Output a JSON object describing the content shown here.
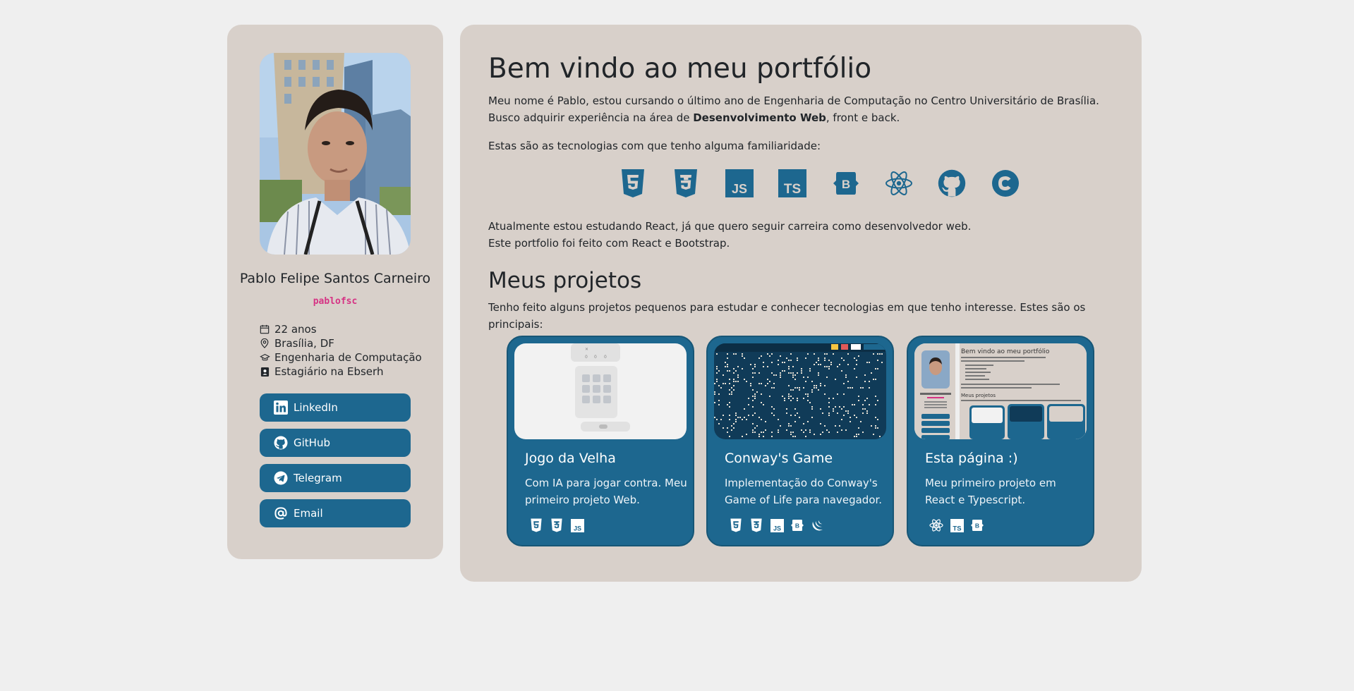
{
  "profile": {
    "name": "Pablo Felipe Santos Carneiro",
    "handle": "pablofsc",
    "info": [
      {
        "icon": "calendar-icon",
        "text": "22 anos"
      },
      {
        "icon": "location-pin-icon",
        "text": "Brasília, DF"
      },
      {
        "icon": "graduation-cap-icon",
        "text": "Engenharia de Computação"
      },
      {
        "icon": "badge-icon",
        "text": "Estagiário na Ebserh"
      }
    ],
    "links": [
      {
        "icon": "linkedin-icon",
        "label": "LinkedIn"
      },
      {
        "icon": "github-icon",
        "label": "GitHub"
      },
      {
        "icon": "telegram-icon",
        "label": "Telegram"
      },
      {
        "icon": "at-icon",
        "label": "Email"
      }
    ]
  },
  "intro": {
    "title": "Bem vindo ao meu portfólio",
    "line1": "Meu nome é Pablo, estou cursando o último ano de Engenharia de Computação no Centro Universitário de Brasília.",
    "line2_pre": "Busco adquirir experiência na área de ",
    "line2_bold": "Desenvolvimento Web",
    "line2_post": ", front e back.",
    "tech_intro": "Estas são as tecnologias com que tenho alguma familiaridade:",
    "technologies": [
      "html5-icon",
      "css3-icon",
      "javascript-icon",
      "typescript-icon",
      "bootstrap-icon",
      "react-icon",
      "github-icon",
      "c-language-icon"
    ],
    "studying": "Atualmente estou estudando React, já que quero seguir carreira como desenvolvedor web.",
    "built_with": "Este portfolio foi feito com React e Bootstrap."
  },
  "projects": {
    "title": "Meus projetos",
    "intro": "Tenho feito alguns projetos pequenos para estudar e conhecer tecnologias em que tenho interesse. Estes são os principais:",
    "items": [
      {
        "title": "Jogo da Velha",
        "description": "Com IA para jogar contra. Meu primeiro projeto Web.",
        "tags": [
          "html5-icon",
          "css3-icon",
          "javascript-icon"
        ]
      },
      {
        "title": "Conway's Game",
        "description": "Implementação do Conway's Game of Life para navegador.",
        "tags": [
          "html5-icon",
          "css3-icon",
          "javascript-icon",
          "bootstrap-icon",
          "jquery-icon"
        ]
      },
      {
        "title": "Esta página :)",
        "description": "Meu primeiro projeto em React e Typescript.",
        "tags": [
          "react-icon",
          "typescript-icon",
          "bootstrap-icon"
        ]
      }
    ]
  },
  "colors": {
    "accent": "#1d678f",
    "panel": "#d8d0ca",
    "background": "#efefef",
    "handle": "#d63384"
  }
}
